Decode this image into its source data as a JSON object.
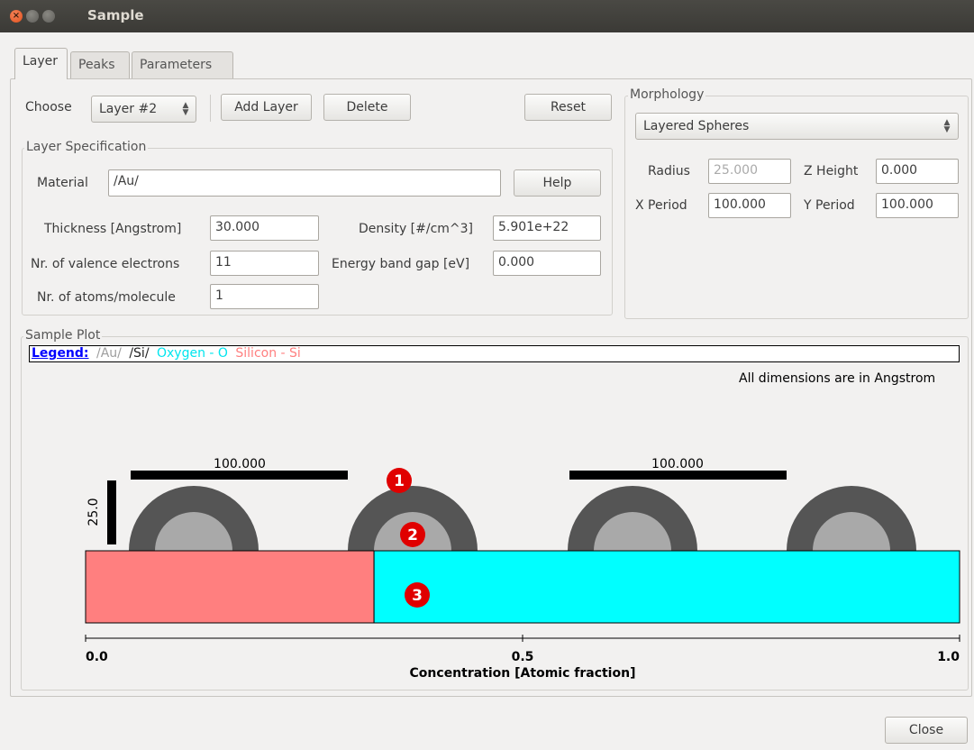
{
  "window": {
    "title": "Sample"
  },
  "tabs": [
    "Layer",
    "Peaks",
    "Parameters"
  ],
  "layer": {
    "choose_label": "Choose",
    "choose_value": "Layer #2",
    "add_layer": "Add Layer",
    "delete": "Delete",
    "reset": "Reset",
    "spec_title": "Layer Specification",
    "material_label": "Material",
    "material_value": "/Au/",
    "help": "Help",
    "thickness_label": "Thickness [Angstrom]",
    "thickness_value": "30.000",
    "density_label": "Density [#/cm^3]",
    "density_value": "5.901e+22",
    "valence_label": "Nr. of valence electrons",
    "valence_value": "11",
    "bandgap_label": "Energy band gap [eV]",
    "bandgap_value": "0.000",
    "atoms_label": "Nr. of atoms/molecule",
    "atoms_value": "1"
  },
  "morphology": {
    "title": "Morphology",
    "type": "Layered Spheres",
    "radius_label": "Radius",
    "radius_value": "25.000",
    "zheight_label": "Z Height",
    "zheight_value": "0.000",
    "xperiod_label": "X Period",
    "xperiod_value": "100.000",
    "yperiod_label": "Y Period",
    "yperiod_value": "100.000"
  },
  "plot": {
    "title": "Sample Plot",
    "legend_label": "Legend:",
    "legend_items": [
      {
        "text": "/Au/",
        "color": "#9e9e9e"
      },
      {
        "text": "/Si/",
        "color": "#222222"
      },
      {
        "text": "Oxygen - O",
        "color": "#00e5ee"
      },
      {
        "text": "Silicon - Si",
        "color": "#ff7f7f"
      }
    ],
    "dims_note": "All dimensions are in Angstrom",
    "period_label_1": "100.000",
    "period_label_2": "100.000",
    "height_label": "25.0",
    "markers": [
      "1",
      "2",
      "3"
    ],
    "axis_ticks": [
      "0.0",
      "0.5",
      "1.0"
    ],
    "axis_label": "Concentration [Atomic fraction]",
    "silicon_fraction": 0.33,
    "colors": {
      "silicon": "#ff7f7f",
      "oxygen": "#00ffff",
      "shell": "#555555",
      "core": "#a9a9a9",
      "marker": "#e00000"
    }
  },
  "footer": {
    "close": "Close"
  }
}
